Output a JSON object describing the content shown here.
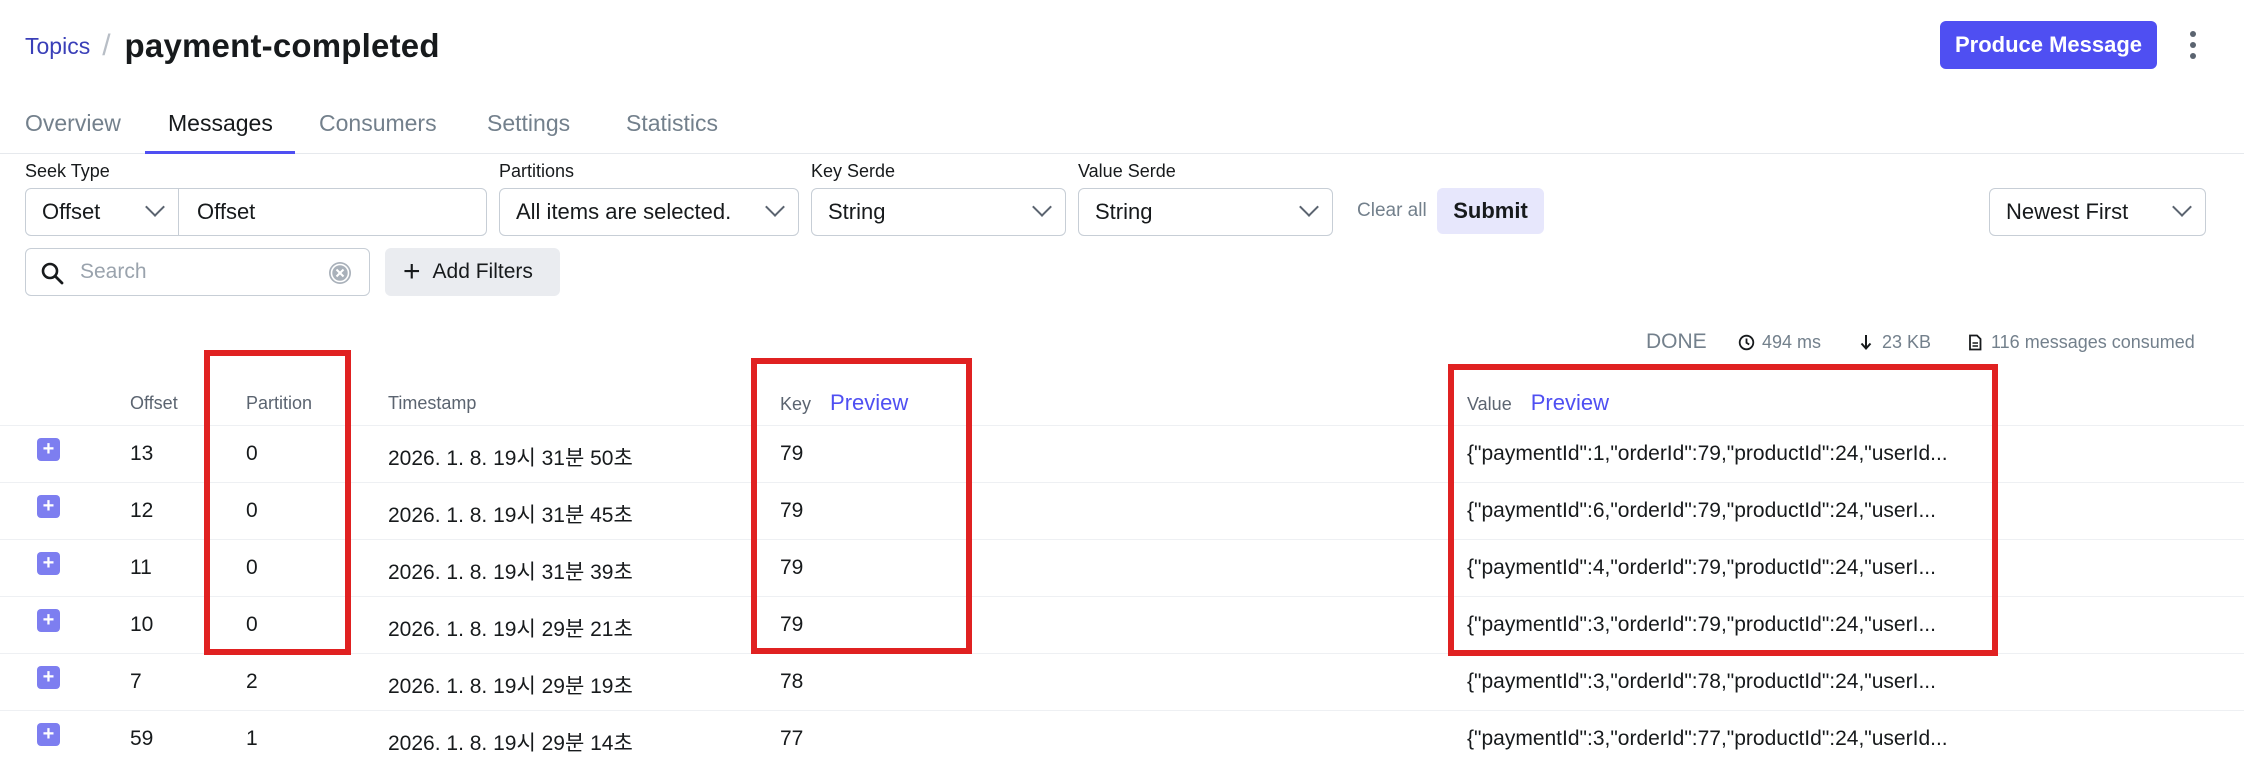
{
  "header": {
    "breadcrumb_link": "Topics",
    "separator": "/",
    "title": "payment-completed",
    "produce_button": "Produce Message"
  },
  "tabs": [
    "Overview",
    "Messages",
    "Consumers",
    "Settings",
    "Statistics"
  ],
  "active_tab": "Messages",
  "filters": {
    "seek_type_label": "Seek Type",
    "seek_type_value": "Offset",
    "seek_input_value": "Offset",
    "partitions_label": "Partitions",
    "partitions_value": "All items are selected.",
    "key_serde_label": "Key Serde",
    "key_serde_value": "String",
    "value_serde_label": "Value Serde",
    "value_serde_value": "String",
    "clear_all": "Clear all",
    "submit": "Submit",
    "sort_value": "Newest First",
    "search_placeholder": "Search",
    "add_filters": "Add Filters"
  },
  "status": {
    "state": "DONE",
    "elapsed": "494 ms",
    "bytes": "23 KB",
    "consumed": "116 messages consumed"
  },
  "table": {
    "columns": {
      "offset": "Offset",
      "partition": "Partition",
      "timestamp": "Timestamp",
      "key": "Key",
      "key_preview": "Preview",
      "value": "Value",
      "value_preview": "Preview"
    },
    "rows": [
      {
        "offset": "13",
        "partition": "0",
        "timestamp": "2026. 1. 8. 19시 31분 50초",
        "key": "79",
        "value": "{\"paymentId\":1,\"orderId\":79,\"productId\":24,\"userId..."
      },
      {
        "offset": "12",
        "partition": "0",
        "timestamp": "2026. 1. 8. 19시 31분 45초",
        "key": "79",
        "value": "{\"paymentId\":6,\"orderId\":79,\"productId\":24,\"userI..."
      },
      {
        "offset": "11",
        "partition": "0",
        "timestamp": "2026. 1. 8. 19시 31분 39초",
        "key": "79",
        "value": "{\"paymentId\":4,\"orderId\":79,\"productId\":24,\"userI..."
      },
      {
        "offset": "10",
        "partition": "0",
        "timestamp": "2026. 1. 8. 19시 29분 21초",
        "key": "79",
        "value": "{\"paymentId\":3,\"orderId\":79,\"productId\":24,\"userI..."
      },
      {
        "offset": "7",
        "partition": "2",
        "timestamp": "2026. 1. 8. 19시 29분 19초",
        "key": "78",
        "value": "{\"paymentId\":3,\"orderId\":78,\"productId\":24,\"userI..."
      },
      {
        "offset": "59",
        "partition": "1",
        "timestamp": "2026. 1. 8. 19시 29분 14초",
        "key": "77",
        "value": "{\"paymentId\":3,\"orderId\":77,\"productId\":24,\"userId..."
      }
    ]
  },
  "colors": {
    "accent": "#4f4ff2",
    "highlight": "#e02121"
  }
}
